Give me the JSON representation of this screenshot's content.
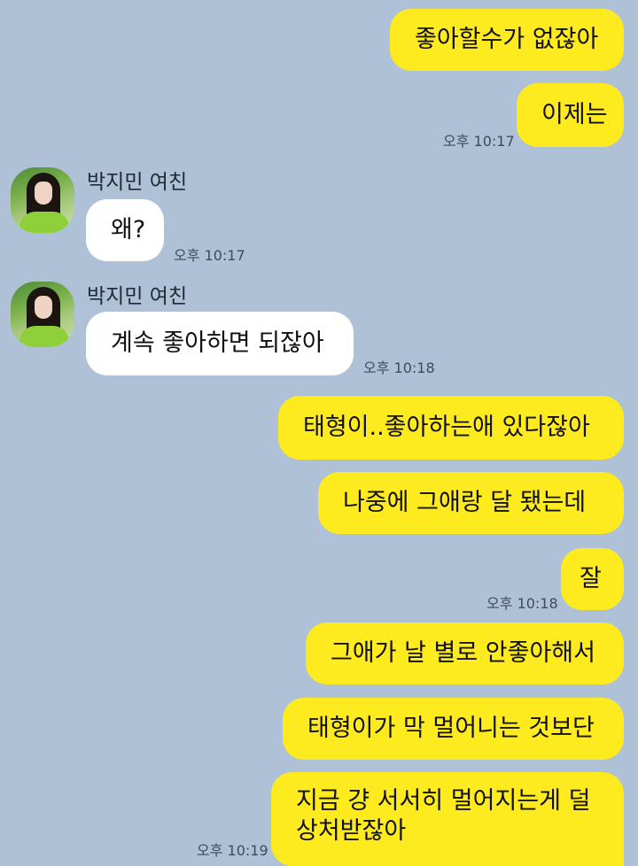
{
  "contact": {
    "name": "박지민 여친",
    "avatar_icon": "profile-photo"
  },
  "colors": {
    "background": "#aec1d6",
    "my_bubble": "#fdea1f",
    "other_bubble": "#ffffff"
  },
  "messages": [
    {
      "sender": "me",
      "text": "좋아할수가 없잖아"
    },
    {
      "sender": "me",
      "text": "이제는",
      "time": "오후 10:17"
    },
    {
      "sender": "other",
      "text": "왜?",
      "time": "오후 10:17"
    },
    {
      "sender": "other",
      "text": "계속 좋아하면 되잖아",
      "time": "오후 10:18"
    },
    {
      "sender": "me",
      "text": "태형이..좋아하는애 있다잖아"
    },
    {
      "sender": "me",
      "text": "나중에 그애랑 달 됐는데"
    },
    {
      "sender": "me",
      "text": "잘",
      "time": "오후 10:18"
    },
    {
      "sender": "me",
      "text": "그애가 날 별로 안좋아해서"
    },
    {
      "sender": "me",
      "text": "태형이가 막 멀어니는 것보단"
    },
    {
      "sender": "me",
      "text": "지금 걍 서서히 멀어지는게 덜 상처받잖아",
      "time": "오후 10:19"
    }
  ]
}
